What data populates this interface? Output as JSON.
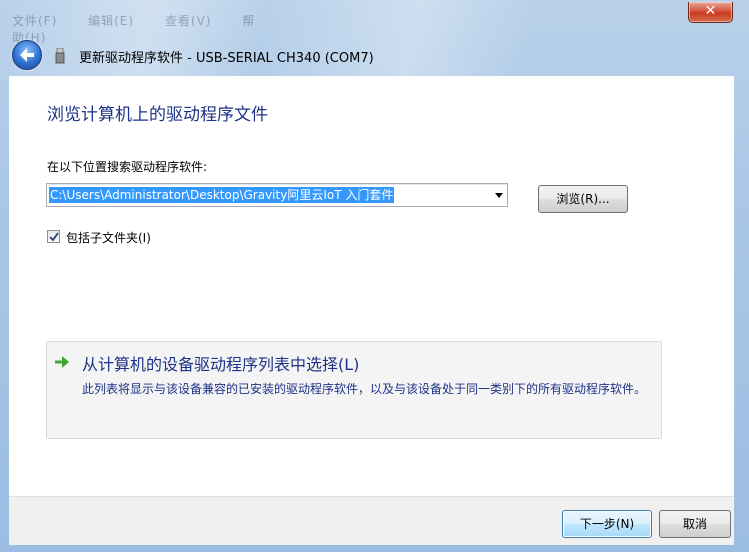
{
  "window": {
    "title": "更新驱动程序软件 - USB-SERIAL CH340 (COM7)",
    "close_label": "✕",
    "background_menu": [
      "文件(F)",
      "编辑(E)",
      "查看(V)",
      "帮助(H)"
    ]
  },
  "content": {
    "heading": "浏览计算机上的驱动程序文件",
    "search_label": "在以下位置搜索驱动程序软件:",
    "path_value": "C:\\Users\\Administrator\\Desktop\\Gravity阿里云IoT 入门套件",
    "browse_label": "浏览(R)...",
    "include_subfolders_label": "包括子文件夹(I)",
    "include_subfolders_checked": true,
    "pick": {
      "title": "从计算机的设备驱动程序列表中选择(L)",
      "description": "此列表将显示与该设备兼容的已安装的驱动程序软件，以及与该设备处于同一类别下的所有驱动程序软件。"
    }
  },
  "footer": {
    "next_label": "下一步(N)",
    "cancel_label": "取消"
  },
  "colors": {
    "accent": "#1e3287",
    "selection": "#3399ff",
    "close": "#c63b22"
  }
}
